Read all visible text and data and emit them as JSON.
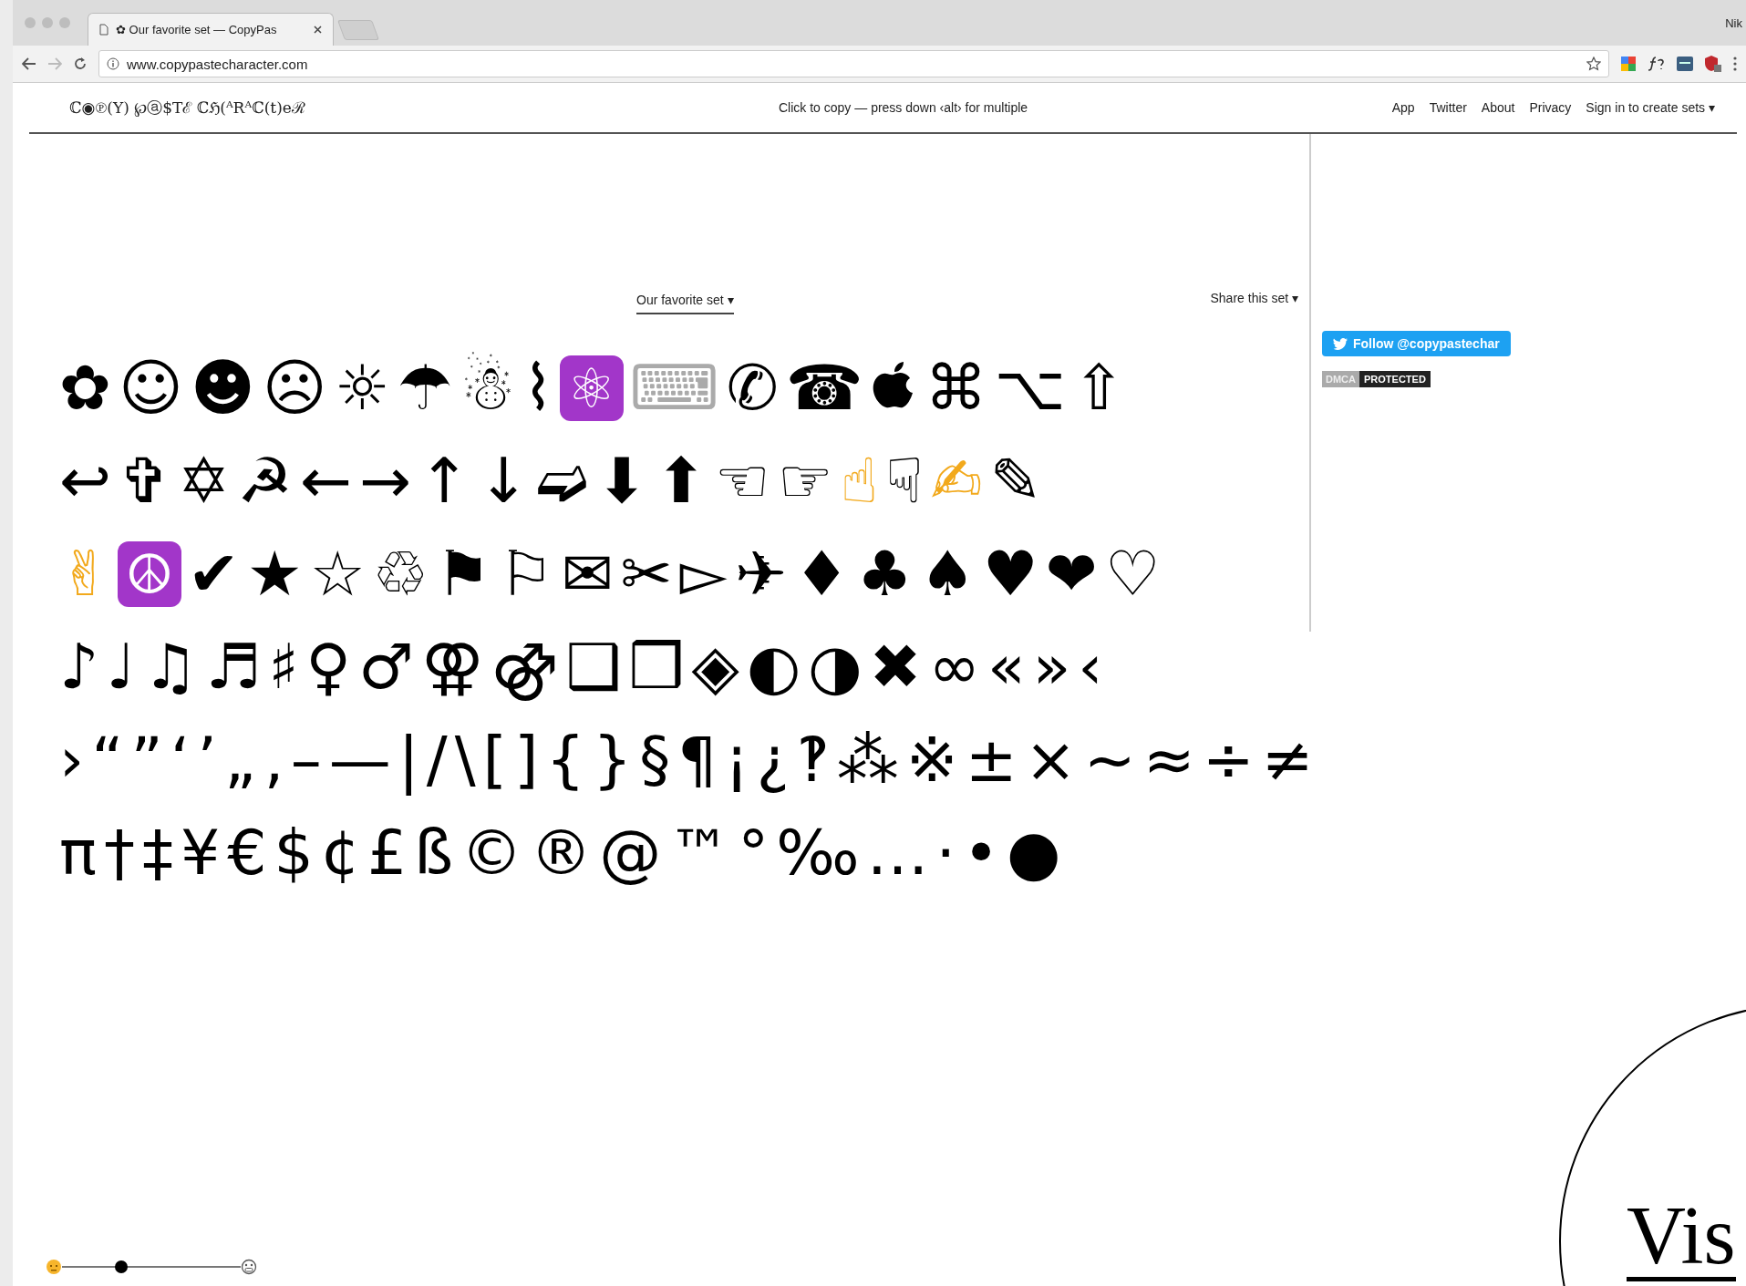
{
  "browser": {
    "tab": {
      "title": "✿ Our favorite set — CopyPas",
      "selected": true
    },
    "profile": "Nik",
    "url": "www.copypastecharacter.com"
  },
  "header": {
    "logo": "ℂ◉℗(Y) ℘ⓐ$Tℰ ℂℌ(ᴬRᴬℂ(t)eℛ",
    "hint": "Click to copy — press down ‹alt› for multiple",
    "nav": [
      {
        "label": "App"
      },
      {
        "label": "Twitter"
      },
      {
        "label": "About"
      },
      {
        "label": "Privacy"
      },
      {
        "label": "Sign in to create sets ▾"
      }
    ]
  },
  "set_menu": "Our favorite set ▾",
  "share_menu": "Share this set ▾",
  "symbol_rows": [
    [
      {
        "kind": "glyph",
        "char": "✿"
      },
      {
        "kind": "glyph",
        "char": "☺"
      },
      {
        "kind": "glyph",
        "char": "☻"
      },
      {
        "kind": "glyph",
        "char": "☹"
      },
      {
        "kind": "glyph",
        "char": "☼"
      },
      {
        "kind": "glyph",
        "char": "☂"
      },
      {
        "kind": "glyph",
        "char": "☃"
      },
      {
        "kind": "glyph",
        "char": "⌇"
      },
      {
        "kind": "badge",
        "char": "⚛"
      },
      {
        "kind": "gray",
        "char": "⌨"
      },
      {
        "kind": "glyph",
        "char": "✆"
      },
      {
        "kind": "glyph",
        "char": "☎"
      },
      {
        "kind": "apple"
      },
      {
        "kind": "glyph",
        "char": "⌘"
      },
      {
        "kind": "glyph",
        "char": "⌥"
      },
      {
        "kind": "glyph",
        "char": "⇧"
      }
    ],
    [
      {
        "kind": "glyph",
        "char": "↩"
      },
      {
        "kind": "glyph",
        "char": "✞"
      },
      {
        "kind": "glyph",
        "char": "✡"
      },
      {
        "kind": "glyph",
        "char": "☭"
      },
      {
        "kind": "glyph",
        "char": "←"
      },
      {
        "kind": "glyph",
        "char": "→"
      },
      {
        "kind": "glyph",
        "char": "↑"
      },
      {
        "kind": "glyph",
        "char": "↓"
      },
      {
        "kind": "glyph",
        "char": "➫"
      },
      {
        "kind": "glyph",
        "char": "⬇"
      },
      {
        "kind": "glyph",
        "char": "⬆"
      },
      {
        "kind": "glyph",
        "char": "☜"
      },
      {
        "kind": "glyph",
        "char": "☞"
      },
      {
        "kind": "emoji",
        "char": "☝"
      },
      {
        "kind": "glyph",
        "char": "☟"
      },
      {
        "kind": "emoji",
        "char": "✍"
      },
      {
        "kind": "glyph",
        "char": "✎"
      }
    ],
    [
      {
        "kind": "emoji",
        "char": "✌"
      },
      {
        "kind": "badge",
        "char": "☮"
      },
      {
        "kind": "glyph",
        "char": "✔"
      },
      {
        "kind": "glyph",
        "char": "★"
      },
      {
        "kind": "glyph",
        "char": "☆"
      },
      {
        "kind": "glyph",
        "char": "♲"
      },
      {
        "kind": "glyph",
        "char": "⚑"
      },
      {
        "kind": "glyph",
        "char": "⚐"
      },
      {
        "kind": "glyph",
        "char": "✉"
      },
      {
        "kind": "glyph",
        "char": "✂"
      },
      {
        "kind": "glyph",
        "char": "▻"
      },
      {
        "kind": "glyph",
        "char": "✈"
      },
      {
        "kind": "glyph",
        "char": "♦"
      },
      {
        "kind": "glyph",
        "char": "♣"
      },
      {
        "kind": "glyph",
        "char": "♠"
      },
      {
        "kind": "glyph",
        "char": "♥"
      },
      {
        "kind": "glyph",
        "char": "❤"
      },
      {
        "kind": "glyph",
        "char": "♡"
      }
    ],
    [
      {
        "kind": "glyph",
        "char": "♪"
      },
      {
        "kind": "glyph",
        "char": "♩"
      },
      {
        "kind": "glyph",
        "char": "♫"
      },
      {
        "kind": "glyph",
        "char": "♬"
      },
      {
        "kind": "glyph",
        "char": "♯"
      },
      {
        "kind": "glyph",
        "char": "♀"
      },
      {
        "kind": "glyph",
        "char": "♂"
      },
      {
        "kind": "glyph",
        "char": "⚢"
      },
      {
        "kind": "glyph",
        "char": "⚣"
      },
      {
        "kind": "glyph",
        "char": "❑"
      },
      {
        "kind": "glyph",
        "char": "❒"
      },
      {
        "kind": "glyph",
        "char": "◈"
      },
      {
        "kind": "glyph",
        "char": "◐"
      },
      {
        "kind": "glyph",
        "char": "◑"
      },
      {
        "kind": "glyph",
        "char": "✖"
      },
      {
        "kind": "glyph",
        "char": "∞"
      },
      {
        "kind": "glyph",
        "char": "«"
      },
      {
        "kind": "glyph",
        "char": "»"
      },
      {
        "kind": "glyph",
        "char": "‹"
      }
    ],
    [
      {
        "kind": "glyph",
        "char": "›"
      },
      {
        "kind": "glyph",
        "char": "“"
      },
      {
        "kind": "glyph",
        "char": "”"
      },
      {
        "kind": "glyph",
        "char": "‘"
      },
      {
        "kind": "glyph",
        "char": "’"
      },
      {
        "kind": "glyph",
        "char": "„"
      },
      {
        "kind": "glyph",
        "char": "‚"
      },
      {
        "kind": "glyph",
        "char": "–"
      },
      {
        "kind": "glyph",
        "char": "—"
      },
      {
        "kind": "glyph",
        "char": "|"
      },
      {
        "kind": "glyph",
        "char": "/"
      },
      {
        "kind": "glyph",
        "char": "\\"
      },
      {
        "kind": "glyph",
        "char": "["
      },
      {
        "kind": "glyph",
        "char": "]"
      },
      {
        "kind": "glyph",
        "char": "{"
      },
      {
        "kind": "glyph",
        "char": "}"
      },
      {
        "kind": "glyph",
        "char": "§"
      },
      {
        "kind": "glyph",
        "char": "¶"
      },
      {
        "kind": "glyph",
        "char": "¡"
      },
      {
        "kind": "glyph",
        "char": "¿"
      },
      {
        "kind": "glyph",
        "char": "‽"
      },
      {
        "kind": "glyph",
        "char": "⁂"
      },
      {
        "kind": "glyph",
        "char": "※"
      },
      {
        "kind": "glyph",
        "char": "±"
      },
      {
        "kind": "glyph",
        "char": "×"
      },
      {
        "kind": "glyph",
        "char": "~"
      },
      {
        "kind": "glyph",
        "char": "≈"
      },
      {
        "kind": "glyph",
        "char": "÷"
      },
      {
        "kind": "glyph",
        "char": "≠"
      }
    ],
    [
      {
        "kind": "glyph",
        "char": "π"
      },
      {
        "kind": "glyph",
        "char": "†"
      },
      {
        "kind": "glyph",
        "char": "‡"
      },
      {
        "kind": "glyph",
        "char": "¥"
      },
      {
        "kind": "glyph",
        "char": "€"
      },
      {
        "kind": "glyph",
        "char": "$"
      },
      {
        "kind": "glyph",
        "char": "¢"
      },
      {
        "kind": "glyph",
        "char": "£"
      },
      {
        "kind": "glyph",
        "char": "ß"
      },
      {
        "kind": "glyph",
        "char": "©"
      },
      {
        "kind": "glyph",
        "char": "®"
      },
      {
        "kind": "glyph",
        "char": "@"
      },
      {
        "kind": "glyph",
        "char": "™"
      },
      {
        "kind": "glyph",
        "char": "°"
      },
      {
        "kind": "glyph",
        "char": "‰"
      },
      {
        "kind": "glyph",
        "char": "…"
      },
      {
        "kind": "glyph",
        "char": "·"
      },
      {
        "kind": "glyph",
        "char": "•"
      },
      {
        "kind": "glyph",
        "char": "●"
      }
    ]
  ],
  "sidebar": {
    "follow_button": "Follow @copypastechar",
    "dmca": [
      "DMCA",
      "PROTECTED"
    ]
  },
  "size_slider": {
    "level": 0.33
  },
  "overlay_text": "Vis"
}
